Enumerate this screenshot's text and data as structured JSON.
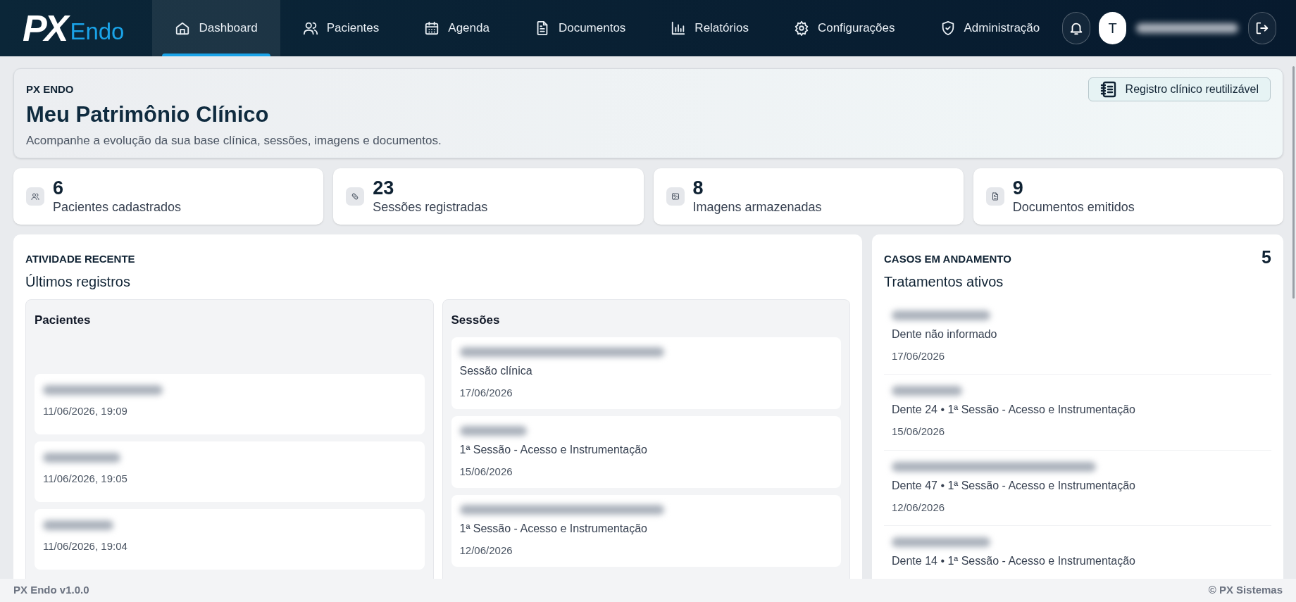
{
  "brand": {
    "mark": "PX",
    "name": "Endo"
  },
  "nav": [
    {
      "label": "Dashboard",
      "kind": "home",
      "selected": true
    },
    {
      "label": "Pacientes",
      "kind": "users",
      "selected": false
    },
    {
      "label": "Agenda",
      "kind": "calendar",
      "selected": false
    },
    {
      "label": "Documentos",
      "kind": "document",
      "selected": false
    },
    {
      "label": "Relatórios",
      "kind": "chart",
      "selected": false
    },
    {
      "label": "Configurações",
      "kind": "gear",
      "selected": false
    },
    {
      "label": "Administração",
      "kind": "shield",
      "selected": false
    }
  ],
  "user": {
    "initial": "T",
    "email_redacted": true
  },
  "header": {
    "eyebrow": "PX ENDO",
    "title": "Meu Patrimônio Clínico",
    "subtitle": "Acompanhe a evolução da sua base clínica, sessões, imagens e documentos.",
    "button": "Registro clínico reutilizável"
  },
  "stats": [
    {
      "value": "6",
      "label": "Pacientes cadastrados",
      "kind": "users"
    },
    {
      "value": "23",
      "label": "Sessões registradas",
      "kind": "pill"
    },
    {
      "value": "8",
      "label": "Imagens armazenadas",
      "kind": "image"
    },
    {
      "value": "9",
      "label": "Documentos emitidos",
      "kind": "document"
    }
  ],
  "recent": {
    "eyebrow": "ATIVIDADE RECENTE",
    "title": "Últimos registros",
    "patients": {
      "title": "Pacientes",
      "items": [
        {
          "name_redacted": true,
          "time": "11/06/2026, 19:09"
        },
        {
          "name_redacted": true,
          "time": "11/06/2026, 19:05"
        },
        {
          "name_redacted": true,
          "time": "11/06/2026, 19:04"
        }
      ]
    },
    "sessions": {
      "title": "Sessões",
      "items": [
        {
          "name_redacted": true,
          "type": "Sessão clínica",
          "date": "17/06/2026"
        },
        {
          "name_redacted": true,
          "type": "1ª Sessão - Acesso e Instrumentação",
          "date": "15/06/2026"
        },
        {
          "name_redacted": true,
          "type": "1ª Sessão - Acesso e Instrumentação",
          "date": "12/06/2026"
        }
      ]
    }
  },
  "cases": {
    "eyebrow": "CASOS EM ANDAMENTO",
    "count": "5",
    "title": "Tratamentos ativos",
    "items": [
      {
        "name_redacted": true,
        "detail": "Dente não informado",
        "date": "17/06/2026"
      },
      {
        "name_redacted": true,
        "detail": "Dente 24 • 1ª Sessão - Acesso e Instrumentação",
        "date": "15/06/2026"
      },
      {
        "name_redacted": true,
        "detail": "Dente 47 • 1ª Sessão - Acesso e Instrumentação",
        "date": "12/06/2026"
      },
      {
        "name_redacted": true,
        "detail": "Dente 14 • 1ª Sessão - Acesso e Instrumentação"
      }
    ]
  },
  "footer": {
    "version": "PX Endo v1.0.0",
    "copyright": "© PX Sistemas"
  }
}
